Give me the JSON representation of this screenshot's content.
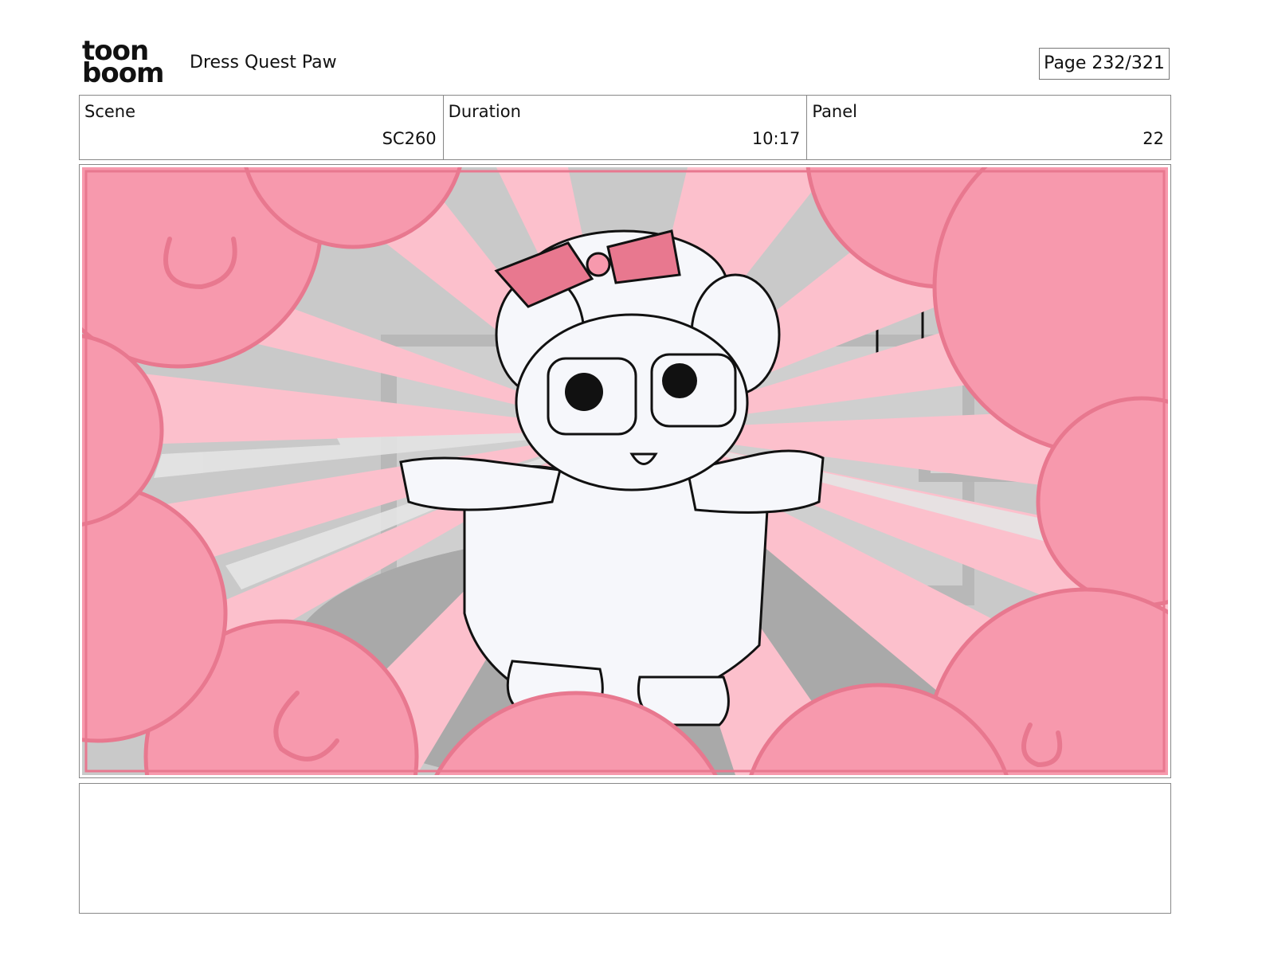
{
  "header": {
    "logo_line1": "toon",
    "logo_line2": "boom",
    "project_title": "Dress Quest Paw",
    "page_label": "Page 232/321"
  },
  "info": {
    "scene_label": "Scene",
    "scene_value": "SC260",
    "duration_label": "Duration",
    "duration_value": "10:17",
    "panel_label": "Panel",
    "panel_value": "22"
  },
  "colors": {
    "cloud_pink": "#f799ad",
    "burst_pink": "#fcc0cc",
    "cloud_outline": "#e8788f",
    "background_gray": "#c8c8c8",
    "character_white": "#f6f7fb"
  },
  "notes": {
    "text": ""
  }
}
